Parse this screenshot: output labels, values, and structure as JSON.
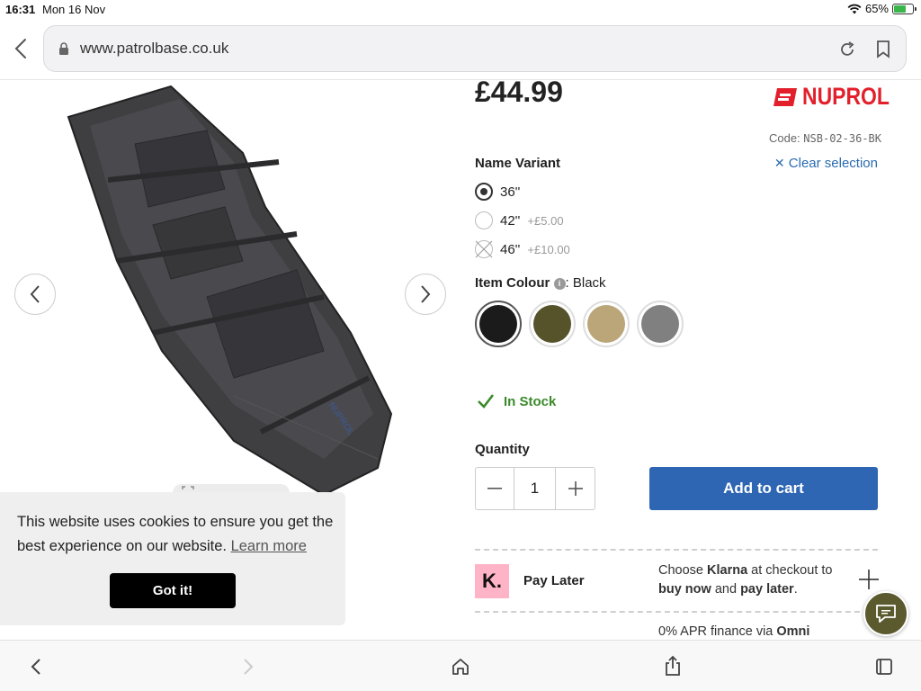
{
  "status_bar": {
    "time": "16:31",
    "date": "Mon 16 Nov",
    "battery": "65%"
  },
  "browser": {
    "url": "www.patrolbase.co.uk"
  },
  "product": {
    "price": "£44.99",
    "brand": "NUPROL",
    "code_label": "Code:",
    "code": "NSB-02-36-BK",
    "variant_label": "Name Variant",
    "clear_selection": "Clear selection",
    "variants": [
      {
        "label": "36''",
        "surcharge": "",
        "state": "selected"
      },
      {
        "label": "42''",
        "surcharge": "+£5.00",
        "state": "available"
      },
      {
        "label": "46''",
        "surcharge": "+£10.00",
        "state": "unavailable"
      }
    ],
    "colour_label": "Item Colour",
    "colour_value": ": Black",
    "colours": [
      {
        "name": "Black",
        "hex": "#1b1b1b",
        "selected": true
      },
      {
        "name": "Olive",
        "hex": "#565229",
        "selected": false
      },
      {
        "name": "Tan",
        "hex": "#bba679",
        "selected": false
      },
      {
        "name": "Grey",
        "hex": "#808080",
        "selected": false
      }
    ],
    "stock": "In Stock",
    "quantity_label": "Quantity",
    "quantity": "1",
    "add_to_cart": "Add to cart",
    "image_bag_label": "NUPROL"
  },
  "klarna": {
    "logo": "K.",
    "title": "Pay Later",
    "text_1": "Choose ",
    "text_bold_1": "Klarna",
    "text_2": " at checkout to ",
    "text_bold_2": "buy now",
    "text_3": " and ",
    "text_bold_3": "pay later",
    "text_4": "."
  },
  "finance": {
    "text_1": "0% APR finance via ",
    "text_bold": "Omni"
  },
  "cookie": {
    "message": "This website uses cookies to ensure you get the best experience on our website.",
    "learn_more": "Learn more",
    "button": "Got it!"
  },
  "colors": {
    "accent": "#2e66b3",
    "brand_red": "#e2202c",
    "stock_green": "#3a8a2a",
    "klarna_pink": "#ffb3c7",
    "chat": "#5b5a2e"
  }
}
